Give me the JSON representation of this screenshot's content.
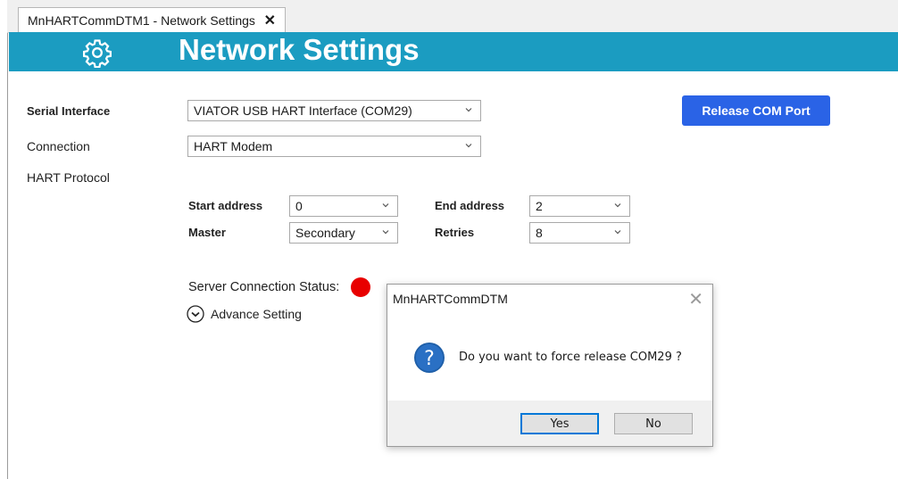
{
  "tab": {
    "title": "MnHARTCommDTM1 - Network Settings",
    "close_glyph": "✕"
  },
  "header": {
    "title": "Network Settings",
    "icon": "gear-icon",
    "bg_color": "#1b9cc1"
  },
  "form": {
    "serial_interface": {
      "label": "Serial Interface",
      "value": "VIATOR USB HART Interface (COM29)"
    },
    "connection": {
      "label": "Connection",
      "value": "HART Modem"
    },
    "hart_protocol_label": "HART Protocol",
    "start_address": {
      "label": "Start address",
      "value": "0"
    },
    "end_address": {
      "label": "End address",
      "value": "2"
    },
    "master": {
      "label": "Master",
      "value": "Secondary"
    },
    "retries": {
      "label": "Retries",
      "value": "8"
    },
    "server_status_label": "Server Connection Status:",
    "server_status_color": "#e80000",
    "advance_setting_label": "Advance Setting"
  },
  "release_button": {
    "label": "Release COM Port",
    "color": "#2a63e6"
  },
  "dialog": {
    "title": "MnHARTCommDTM",
    "close_glyph": "✕",
    "icon": "question-icon",
    "message": "Do you want to force release COM29 ?",
    "yes_label": "Yes",
    "no_label": "No"
  }
}
